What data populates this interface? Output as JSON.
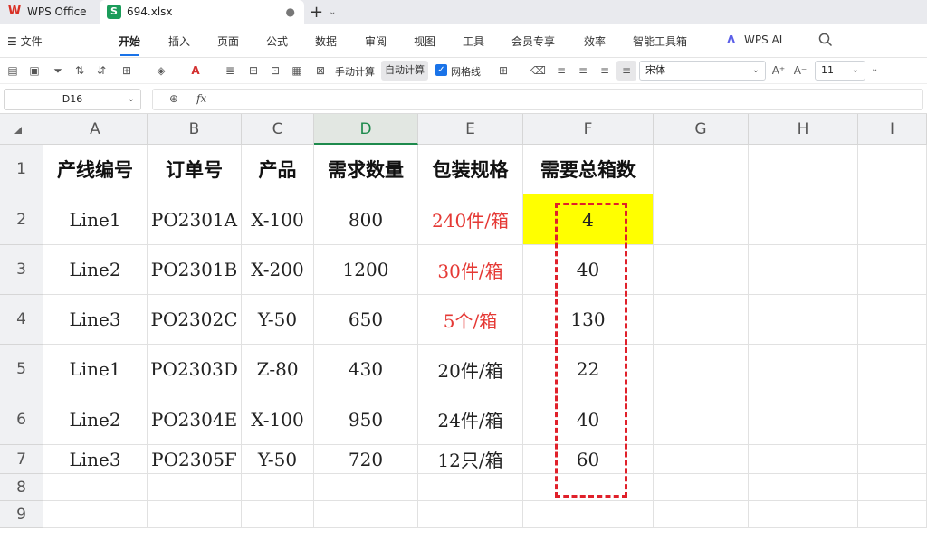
{
  "tabs": {
    "home_label": "WPS Office",
    "file_label": "694.xlsx",
    "file_logo": "S",
    "wps_logo": "W"
  },
  "menu": {
    "file_label": "文件",
    "items": [
      "开始",
      "插入",
      "页面",
      "公式",
      "数据",
      "审阅",
      "视图",
      "工具",
      "会员专享",
      "效率",
      "智能工具箱"
    ],
    "active_index": 0,
    "ai_label": "WPS AI"
  },
  "toolbar": {
    "manual_calc": "手动计算",
    "auto_calc": "自动计算",
    "gridlines_label": "网格线",
    "gridlines_checked": true,
    "font_name": "宋体",
    "font_size": "11"
  },
  "formula_bar": {
    "name_box": "D16",
    "fx_label": "fx",
    "content": ""
  },
  "sheet": {
    "columns": [
      "A",
      "B",
      "C",
      "D",
      "E",
      "F",
      "G",
      "H",
      "I"
    ],
    "selected_column": "D",
    "rows": [
      "1",
      "2",
      "3",
      "4",
      "5",
      "6",
      "7",
      "8",
      "9"
    ],
    "headers": [
      "产线编号",
      "订单号",
      "产品",
      "需求数量",
      "包装规格",
      "需要总箱数"
    ],
    "data": [
      [
        "Line1",
        "PO2301A",
        "X-100",
        "800",
        "240件/箱",
        "4"
      ],
      [
        "Line2",
        "PO2301B",
        "X-200",
        "1200",
        "30件/箱",
        "40"
      ],
      [
        "Line3",
        "PO2302C",
        "Y-50",
        "650",
        "5个/箱",
        "130"
      ],
      [
        "Line1",
        "PO2303D",
        "Z-80",
        "430",
        "20件/箱",
        "22"
      ],
      [
        "Line2",
        "PO2304E",
        "X-100",
        "950",
        "24件/箱",
        "40"
      ],
      [
        "Line3",
        "PO2305F",
        "Y-50",
        "720",
        "12只/箱",
        "60"
      ]
    ],
    "red_spec_rows": [
      0,
      1,
      2
    ],
    "highlight_cell": "F2",
    "highlight_color": "#ffff00",
    "annotation_color": "#e0202a",
    "spec_red_color": "#e53935"
  }
}
